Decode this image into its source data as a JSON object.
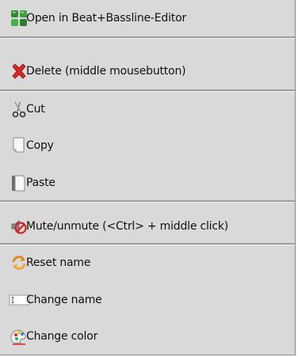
{
  "menu": {
    "items": [
      {
        "label": "Open in Beat+Bassline-Editor",
        "icon": "beat-bassline-editor-icon"
      },
      {
        "label": "Delete (middle mousebutton)",
        "icon": "delete-icon"
      },
      {
        "label": "Cut",
        "icon": "scissors-icon"
      },
      {
        "label": "Copy",
        "icon": "copy-icon"
      },
      {
        "label": "Paste",
        "icon": "paste-icon"
      },
      {
        "label": "Mute/unmute (<Ctrl> + middle click)",
        "icon": "mute-icon"
      },
      {
        "label": "Reset name",
        "icon": "reset-icon"
      },
      {
        "label": "Change name",
        "icon": "rename-icon"
      },
      {
        "label": "Change color",
        "icon": "color-palette-icon"
      }
    ]
  },
  "colors": {
    "menu_background": "#d9d9d9",
    "separator": "#9c9c9c",
    "text": "#111111"
  }
}
